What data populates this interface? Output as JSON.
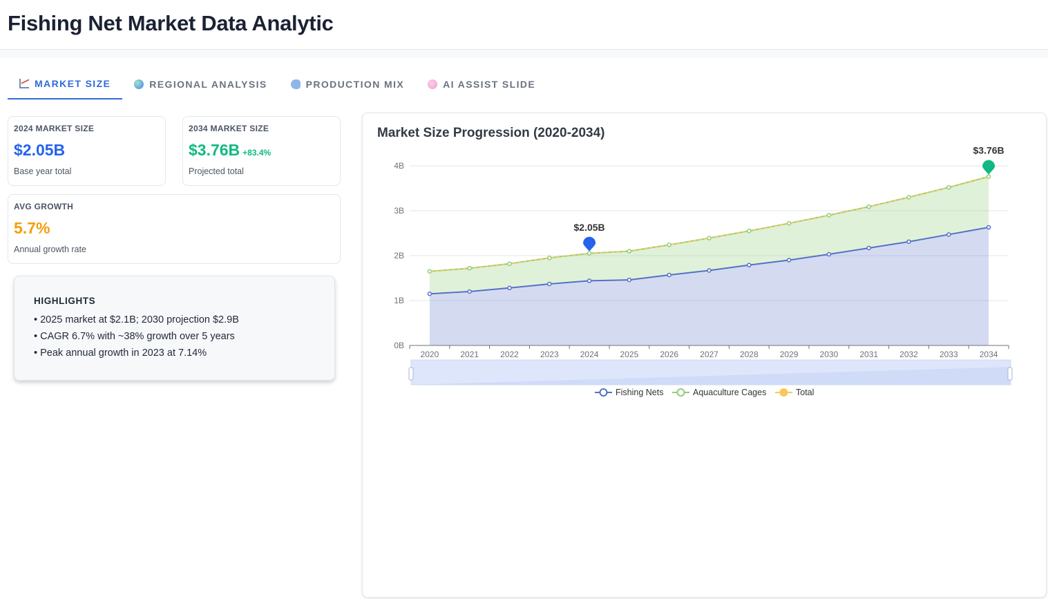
{
  "app": {
    "title": "Fishing Net Market Data Analytic"
  },
  "tabs": [
    {
      "label": "MARKET SIZE",
      "icon": "chart-icon",
      "active": true
    },
    {
      "label": "REGIONAL ANALYSIS",
      "icon": "globe-icon",
      "active": false
    },
    {
      "label": "PRODUCTION MIX",
      "icon": "fish-icon",
      "active": false
    },
    {
      "label": "AI ASSIST SLIDE",
      "icon": "brain-icon",
      "active": false
    }
  ],
  "kpis": {
    "base": {
      "label": "2024 MARKET SIZE",
      "value": "$2.05B",
      "sub": "Base year total",
      "color": "#2563eb"
    },
    "projected": {
      "label": "2034 MARKET SIZE",
      "value": "$3.76B",
      "delta": "+83.4%",
      "sub": "Projected total",
      "color": "#10b981"
    },
    "growth": {
      "label": "AVG GROWTH",
      "value": "5.7%",
      "sub": "Annual growth rate",
      "color": "#f59e0b"
    }
  },
  "highlights": {
    "title": "HIGHLIGHTS",
    "items": [
      "• 2025 market at $2.1B; 2030 projection $2.9B",
      "• CAGR 6.7% with ~38% growth over 5 years",
      "• Peak annual growth in 2023 at 7.14%"
    ]
  },
  "chart_title": "Market Size Progression (2020-2034)",
  "chart_data": {
    "type": "area",
    "stacked": true,
    "x": [
      "2020",
      "2021",
      "2022",
      "2023",
      "2024",
      "2025",
      "2026",
      "2027",
      "2028",
      "2029",
      "2030",
      "2031",
      "2032",
      "2033",
      "2034"
    ],
    "y_ticks": [
      "0B",
      "1B",
      "2B",
      "3B",
      "4B"
    ],
    "ylim": [
      0,
      4
    ],
    "series": [
      {
        "name": "Fishing Nets",
        "color": "#5470c6",
        "values": [
          1.15,
          1.2,
          1.28,
          1.37,
          1.44,
          1.46,
          1.57,
          1.67,
          1.79,
          1.9,
          2.03,
          2.17,
          2.31,
          2.47,
          2.63
        ]
      },
      {
        "name": "Aquaculture Cages",
        "color": "#91cc75",
        "values": [
          0.5,
          0.52,
          0.54,
          0.58,
          0.61,
          0.64,
          0.67,
          0.72,
          0.76,
          0.82,
          0.87,
          0.92,
          0.99,
          1.05,
          1.13
        ]
      },
      {
        "name": "Total",
        "color": "#fac858",
        "values": [
          1.65,
          1.72,
          1.82,
          1.95,
          2.05,
          2.1,
          2.24,
          2.39,
          2.55,
          2.72,
          2.9,
          3.09,
          3.3,
          3.52,
          3.76
        ]
      }
    ],
    "markers": [
      {
        "x": "2024",
        "value": 2.05,
        "label": "$2.05B",
        "color": "#2563eb"
      },
      {
        "x": "2034",
        "value": 3.76,
        "label": "$3.76B",
        "color": "#10b981"
      }
    ],
    "legend_position": "bottom-center",
    "grid": true,
    "data_zoom": true
  }
}
